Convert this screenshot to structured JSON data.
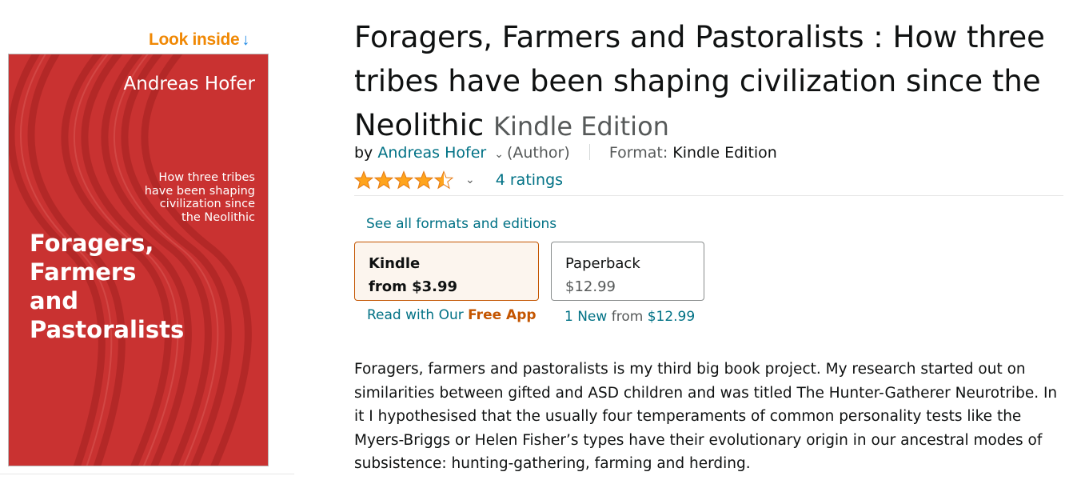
{
  "look_inside": {
    "label": "Look inside",
    "arrow": "↓"
  },
  "cover": {
    "author": "Andreas Hofer",
    "subtitle_lines": [
      "How three tribes",
      "have been shaping",
      "civilization since",
      "the Neolithic"
    ],
    "title_lines": [
      "Foragers,",
      "Farmers",
      "and",
      "Pastoralists"
    ],
    "background_color": "#C93231"
  },
  "product": {
    "title": "Foragers, Farmers and Pastoralists : How three tribes have been shaping civilization since the Neolithic",
    "edition": "Kindle Edition",
    "by_prefix": "by",
    "author": "Andreas Hofer",
    "author_chevron_icon": "chevron-down-icon",
    "author_role": "(Author)",
    "format_label": "Format:",
    "format_value": "Kindle Edition",
    "rating_stars": 4.5,
    "ratings_count": "4 ratings"
  },
  "formats": {
    "see_all": "See all formats and editions",
    "kindle": {
      "name": "Kindle",
      "price": "from $3.99"
    },
    "paperback": {
      "name": "Paperback",
      "price": "$12.99"
    },
    "read_with_prefix": "Read with Our",
    "free_app": "Free App",
    "new_count": "1 New",
    "new_from_word": "from",
    "new_price": "$12.99"
  },
  "description": "Foragers, farmers and pastoralists is my third big book project. My research started out on similarities between gifted and ASD children and was titled The Hunter-Gatherer Neurotribe. In it I hypothesised that the usually four temperaments of common personality tests like the Myers-Briggs or Helen Fisher’s types have their evolutionary origin in our ancestral modes of subsistence: hunting-gathering, farming and herding.",
  "colors": {
    "link": "#007185",
    "star": "#FFA41C",
    "accent_orange": "#C45500",
    "look_inside_orange": "#F08804"
  }
}
